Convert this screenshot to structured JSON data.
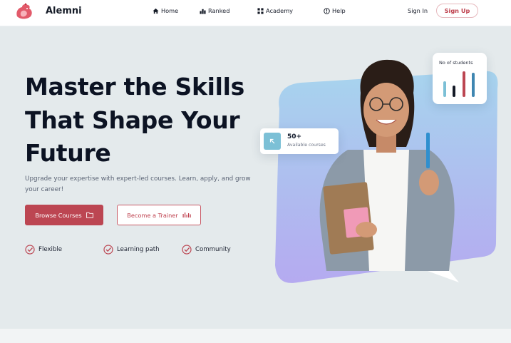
{
  "brand": {
    "name": "Alemni",
    "accent": "#be3f4c",
    "logo_icon": "rooster-logo-icon"
  },
  "nav": {
    "items": [
      {
        "label": "Home",
        "icon": "home-icon"
      },
      {
        "label": "Ranked",
        "icon": "ranked-icon"
      },
      {
        "label": "Academy",
        "icon": "academy-icon"
      },
      {
        "label": "Help",
        "icon": "help-icon"
      }
    ],
    "signin": "Sign In",
    "signup": "Sign Up"
  },
  "hero": {
    "headline": [
      "Master the Skills",
      "That Shape Your",
      "Future"
    ],
    "subtext": "Upgrade your expertise with expert-led courses. Learn, apply, and grow your career!",
    "primary_button": {
      "label": "Browse Courses",
      "icon": "folder-icon"
    },
    "secondary_button": {
      "label": "Become a Trainer",
      "icon": "signal-bars-icon"
    },
    "features": [
      "Flexible",
      "Learning path",
      "Community"
    ]
  },
  "stats": {
    "students_card": {
      "label": "No of students",
      "bar_colors": [
        "#7cc0d6",
        "#141a26",
        "#bc4652",
        "#3f86b1"
      ]
    },
    "courses_card": {
      "value": "50+",
      "label": "Available courses",
      "icon": "arrow-up-left-icon"
    }
  },
  "colors": {
    "primary": "#bc4652",
    "gradient_top": "#a7d4ee",
    "gradient_bottom": "#b2abf0",
    "background": "#e4eaec"
  }
}
